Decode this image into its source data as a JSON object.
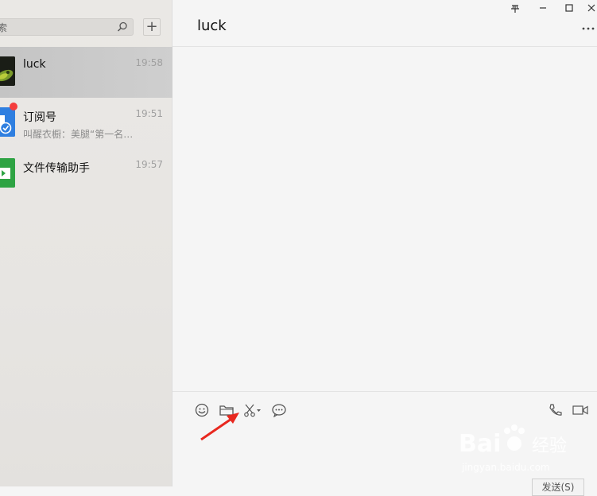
{
  "sidebar": {
    "search": {
      "label": "索",
      "value": "",
      "placeholder": ""
    },
    "add_label": "+",
    "chats": [
      {
        "name": "luck",
        "time": "19:58",
        "preview": "",
        "avatar": "photo-avatar",
        "selected": true,
        "badge": false
      },
      {
        "name": "订阅号",
        "time": "19:51",
        "preview": "叫醒衣橱：美腿“第一名…",
        "avatar": "subscription-icon",
        "selected": false,
        "badge": true
      },
      {
        "name": "文件传输助手",
        "time": "19:57",
        "preview": "",
        "avatar": "file-transfer-icon",
        "selected": false,
        "badge": false
      }
    ]
  },
  "chat": {
    "title": "luck",
    "toolbar": [
      "emoji-icon",
      "folder-icon",
      "scissors-icon",
      "chat-bubble-icon",
      "phone-icon",
      "video-icon"
    ],
    "send_label": "发送(S)"
  },
  "window_controls": [
    "pin-icon",
    "minimize-icon",
    "maximize-icon",
    "close-icon"
  ],
  "watermark": {
    "brand": "Bai",
    "brand2": "经验",
    "url": "jingyan.baidu.com"
  },
  "colors": {
    "accent_red": "#f43d3d",
    "file_green": "#2ea343",
    "subscription_blue": "#2f7fe0",
    "annotation_arrow": "#e8281f"
  }
}
